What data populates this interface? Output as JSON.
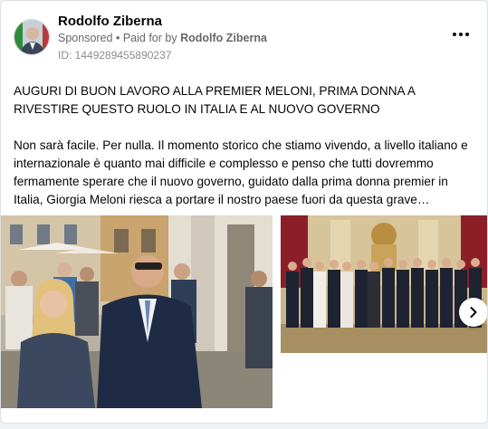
{
  "post": {
    "author": "Rodolfo Ziberna",
    "sponsored_label": "Sponsored",
    "separator": "•",
    "paid_for_prefix": "Paid for by",
    "paid_for_name": "Rodolfo Ziberna",
    "ad_id": "ID: 1449289455890237",
    "headline": "AUGURI DI BUON LAVORO ALLA PREMIER MELONI, PRIMA DONNA A RIVESTIRE QUESTO RUOLO IN ITALIA E AL NUOVO GOVERNO",
    "body": "Non sarà facile. Per nulla. Il momento storico che stiamo vivendo, a livello italiano e internazionale è quanto mai difficile e complesso e penso che tutti dovremmo fermamente sperare che il nuovo governo, guidato dalla prima donna premier in Italia, Giorgia Meloni riesca a portare il nostro paese fuori da questa grave…"
  },
  "icons": {
    "more": "more-options-icon",
    "next": "chevron-right-icon"
  },
  "colors": {
    "text_primary": "#050505",
    "text_secondary": "#65676b",
    "card_bg": "#ffffff",
    "page_bg": "#f0f2f5"
  }
}
